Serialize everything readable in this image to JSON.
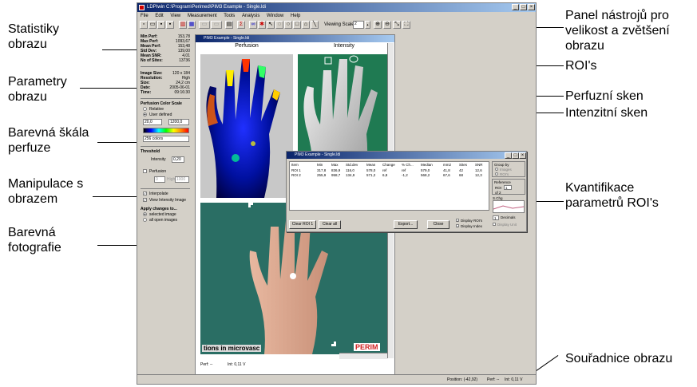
{
  "annotations": {
    "left": [
      "Statistiky obrazu",
      "Parametry obrazu",
      "Barevná škála perfuze",
      "Manipulace s obrazem",
      "Barevná fotografie"
    ],
    "right": [
      "Panel nástrojů pro velikost a zvětšení obrazu",
      "ROI's",
      "Perfuzní sken",
      "Intenzitní sken",
      "Kvantifikace parametrů ROI's",
      "Souřadnice obrazu"
    ]
  },
  "app": {
    "title": "LDPIwin C:\\Program\\Perimed\\PIM3 Example - Single.ldi",
    "menu": [
      "File",
      "Edit",
      "View",
      "Measurement",
      "Tools",
      "Analysis",
      "Window",
      "Help"
    ],
    "viewing_scale_label": "Viewing Scale",
    "viewing_scale_value": "2"
  },
  "stats": {
    "rows": [
      {
        "label": "Min Perf:",
        "value": "153,78"
      },
      {
        "label": "Max Perf:",
        "value": "1093,67"
      },
      {
        "label": "Mean Perf:",
        "value": "153,48"
      },
      {
        "label": "Std Dev:",
        "value": "139,00"
      },
      {
        "label": "Mean SNR:",
        "value": "4,01"
      },
      {
        "label": "No of Sites:",
        "value": "13736"
      }
    ]
  },
  "params": {
    "rows": [
      {
        "label": "Image Size:",
        "value": "120 x 184"
      },
      {
        "label": "Resolution:",
        "value": "High"
      },
      {
        "label": "Size:",
        "value": "24,2 cm"
      },
      {
        "label": "Date:",
        "value": "2005-06-01"
      },
      {
        "label": "Time:",
        "value": "09:16:30"
      }
    ]
  },
  "color_scale": {
    "title": "Perfusion Color Scale",
    "relative": "Relative",
    "user_defined": "User defined",
    "min": "20,0",
    "max": "1200,0",
    "colors": "256 colors"
  },
  "threshold": {
    "title": "Threshold",
    "intensity_label": "Intensity",
    "intensity_value": "0,20",
    "perfusion_label": "Perfusion",
    "perfusion_min": "0",
    "perfusion_max": "1000",
    "high_label": "High"
  },
  "options": {
    "interpolate": "Interpolate",
    "view_intensity": "View Intensity Image",
    "apply_title": "Apply changes to...",
    "selected": "selected image",
    "all_open": "all open images"
  },
  "image_window": {
    "title": "PIM3 Example - Single.ldi",
    "perfusion_label": "Perfusion",
    "intensity_label": "Intensity",
    "photo_text": "PERIM",
    "photo_bottom_text": "tions in microvasc",
    "bottom_perf": "Perf: --",
    "bottom_int": "Int: 0,11 V"
  },
  "roi_window": {
    "title": "PIM3 Example - Single.ldi",
    "headers": [
      "Item",
      "Min",
      "Max",
      "Std.dev",
      "Mean",
      "Change",
      "% Ch...",
      "Median",
      "mm2",
      "Sites",
      "SNR"
    ],
    "rows": [
      [
        "ROI 1",
        "317,8",
        "836,9",
        "116,0",
        "578,0",
        "ref",
        "ref",
        "579,0",
        "41,8",
        "42",
        "12,6"
      ],
      [
        "ROI 2",
        "255,9",
        "958,7",
        "134,9",
        "571,2",
        "6,8",
        "-1,2",
        "568,2",
        "67,6",
        "68",
        "12,3"
      ]
    ],
    "group_by": "Group by",
    "images": "Images",
    "rois": "ROI's",
    "reference": "Reference",
    "roi_label": "ROI",
    "roi_value": "1",
    "of_label": "of 2",
    "sch_label": "S.Chg",
    "decimals": "Decimals",
    "decimals_value": "1",
    "display_unit": "Display Unit",
    "display_rois": "Display ROI's",
    "display_index": "Display Index",
    "btn_clear_roi": "Clear ROI 1",
    "btn_clear_all": "Clear all",
    "btn_export": "Export...",
    "btn_close": "Close"
  },
  "status": {
    "position": "Position: (-42,92)",
    "perf": "Perf: --",
    "int": "Int: 0,11 V"
  },
  "colors": {
    "titlebar_start": "#0a246a",
    "titlebar_end": "#a6caf0",
    "window_bg": "#d4d0c8",
    "intensity_bg": "#1f7a52",
    "photo_bg": "#2a6e64",
    "perfusion_bg": "#000000"
  }
}
